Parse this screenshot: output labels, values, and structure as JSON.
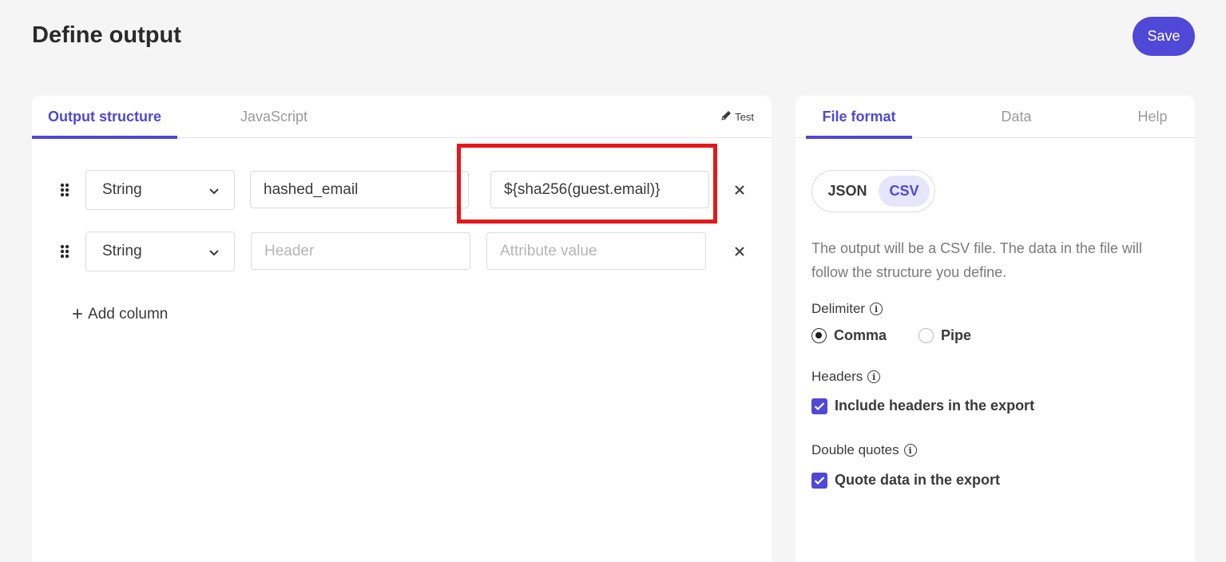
{
  "page": {
    "title": "Define output",
    "save_label": "Save"
  },
  "left_panel": {
    "tabs": [
      {
        "label": "Output structure",
        "active": true
      },
      {
        "label": "JavaScript",
        "active": false
      }
    ],
    "test_label": "Test",
    "rows": [
      {
        "type": "String",
        "header_value": "hashed_email",
        "header_placeholder": "Header",
        "attribute_value": "${sha256(guest.email)}",
        "attribute_placeholder": "Attribute value",
        "highlighted": true
      },
      {
        "type": "String",
        "header_value": "",
        "header_placeholder": "Header",
        "attribute_value": "",
        "attribute_placeholder": "Attribute value",
        "highlighted": false
      }
    ],
    "add_column_label": "Add column"
  },
  "right_panel": {
    "tabs": [
      {
        "label": "File format",
        "active": true
      },
      {
        "label": "Data",
        "active": false
      },
      {
        "label": "Help",
        "active": false
      }
    ],
    "format_options": [
      {
        "label": "JSON",
        "selected": false
      },
      {
        "label": "CSV",
        "selected": true
      }
    ],
    "description": "The output will be a CSV file. The data in the file will follow the structure you define.",
    "delimiter": {
      "label": "Delimiter",
      "options": [
        {
          "label": "Comma",
          "selected": true
        },
        {
          "label": "Pipe",
          "selected": false
        }
      ]
    },
    "headers": {
      "label": "Headers",
      "checkbox_label": "Include headers in the export",
      "checked": true
    },
    "double_quotes": {
      "label": "Double quotes",
      "checkbox_label": "Quote data in the export",
      "checked": true
    }
  },
  "colors": {
    "accent": "#5048d6",
    "highlight": "#e3191c",
    "background": "#f5f5f5"
  }
}
